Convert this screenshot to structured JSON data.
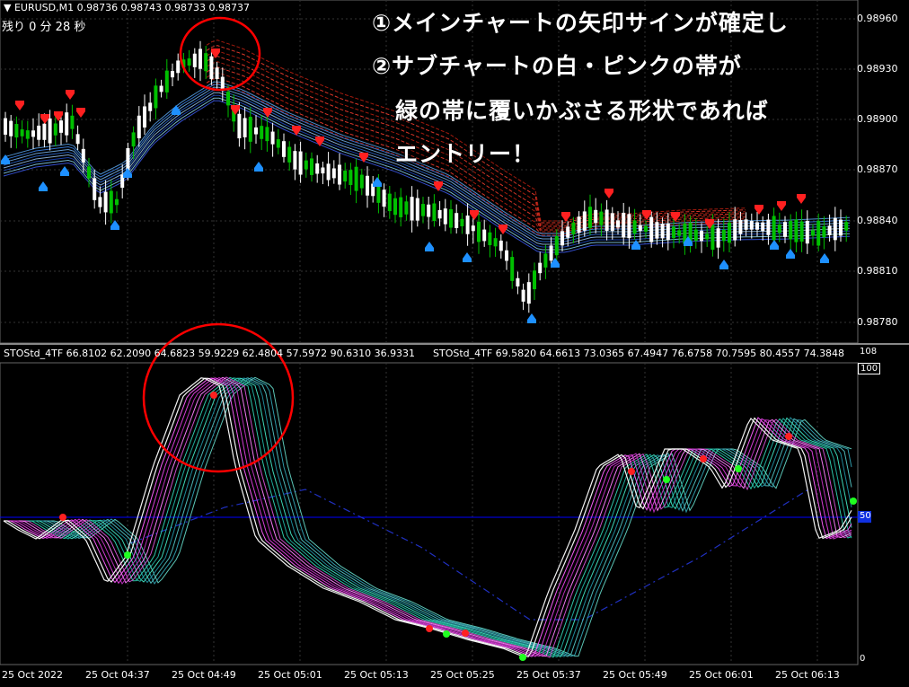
{
  "header": {
    "symbol_line": "▼ EURUSD,M1  0.98736 0.98743 0.98733 0.98737",
    "timer": "残り  0 分  28 秒"
  },
  "indicator_header": {
    "left": "STOStd_4TF 66.8102 62.2090 64.6823 59.9229 62.4804 57.5972 90.6310 36.9331",
    "right": "STOStd_4TF 69.5820 64.6613 73.0365 67.4947 76.6758 70.7595 80.4557 74.3848"
  },
  "annotation": {
    "line1": "①メインチャートの矢印サインが確定し",
    "line2": "②サブチャートの白・ピンクの帯が",
    "line3": "緑の帯に覆いかぶさる形状であれば",
    "line4": "エントリー！"
  },
  "price_axis": [
    "0.98960",
    "0.98930",
    "0.98900",
    "0.98870",
    "0.98840",
    "0.98810",
    "0.98780"
  ],
  "indicator_axis": {
    "top": "108",
    "max": "100",
    "mid": "50",
    "min": "0"
  },
  "time_axis": [
    "25 Oct 2022",
    "25 Oct 04:37",
    "25 Oct 04:49",
    "25 Oct 05:01",
    "25 Oct 05:13",
    "25 Oct 05:25",
    "25 Oct 05:37",
    "25 Oct 05:49",
    "25 Oct 06:01",
    "25 Oct 06:13"
  ],
  "colors": {
    "background": "#000000",
    "bull_candle": "#00c000",
    "bear_candle": "#ffffff",
    "buy_arrow": "#1e90ff",
    "sell_arrow": "#ff2020",
    "band_white": "#ffffff",
    "band_pink": "#ff40ff",
    "band_green": "#20c0a0",
    "level_line": "#0000ff",
    "highlight_circle": "#ff0000"
  }
}
